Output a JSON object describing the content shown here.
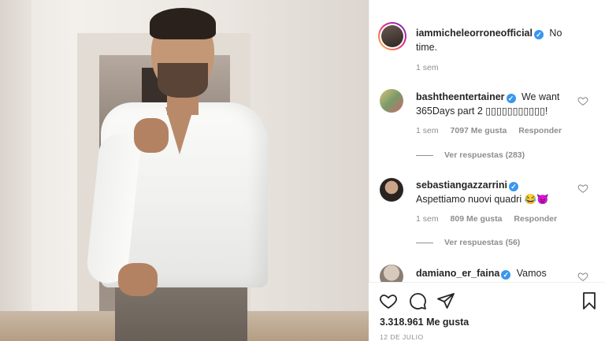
{
  "post": {
    "author": "iammicheleorroneofficial",
    "caption": "No time.",
    "time": "1 sem"
  },
  "comments": [
    {
      "user": "bashtheentertainer",
      "text": "We want 365Days part 2 ▯▯▯▯▯▯▯▯▯▯▯!",
      "text_line1": "We want",
      "text_line2": "365Days part 2 ▯▯▯▯▯▯▯▯▯▯▯!",
      "time": "1 sem",
      "likes": "7097 Me gusta",
      "reply": "Responder",
      "view_replies": "Ver respuestas (283)"
    },
    {
      "user": "sebastiangazzarrini",
      "text": "Aspettiamo nuovi quadri 😂😈",
      "time": "1 sem",
      "likes": "809 Me gusta",
      "reply": "Responder",
      "view_replies": "Ver respuestas (56)"
    },
    {
      "user": "damiano_er_faina",
      "text": "Vamos"
    }
  ],
  "footer": {
    "likes": "3.318.961 Me gusta",
    "date": "12 DE JULIO"
  },
  "icons": {
    "like": "heart-icon",
    "comment": "comment-icon",
    "share": "share-icon",
    "save": "bookmark-icon"
  },
  "colors": {
    "verified": "#3897f0",
    "text": "#262626",
    "muted": "#8e8e8e"
  }
}
